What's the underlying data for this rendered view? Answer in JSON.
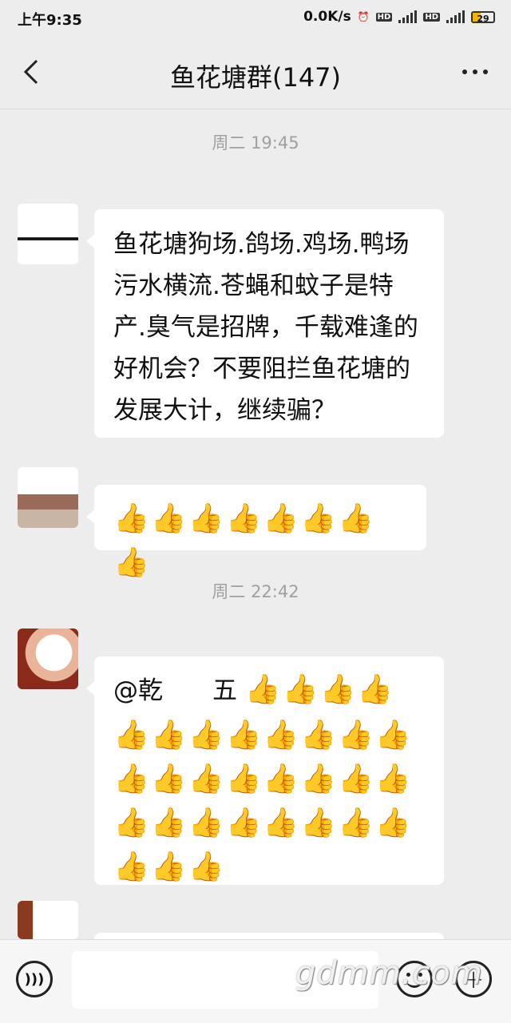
{
  "status_bar": {
    "time": "上午9:35",
    "speed": "0.0K/s",
    "alarm_icon": "alarm-icon",
    "hd1": "HD",
    "net1": "4G",
    "hd2": "HD",
    "net2": "4G",
    "battery": "29"
  },
  "header": {
    "title": "鱼花塘群(147)",
    "back_icon": "back-chevron-icon",
    "more_icon": "more-dots-icon"
  },
  "messages": [
    {
      "timestamp": "周二 19:45",
      "text": "鱼花塘狗场.鸽场.鸡场.鸭场污水横流.苍蝇和蚊子是特产.臭气是招牌，千载难逢的好机会？不要阻拦鱼花塘的发展大计，继续骗？"
    },
    {
      "text": "👍👍👍👍👍👍👍👍"
    },
    {
      "timestamp": "周二 22:42",
      "mention_prefix": "@乾",
      "mention_suffix": "五 ",
      "thumbs_line1": "👍👍👍👍",
      "thumbs_line2": "👍👍👍👍👍👍👍👍",
      "thumbs_line3": "👍👍👍👍👍👍👍👍",
      "thumbs_line4": "👍👍👍👍👍👍👍👍",
      "thumbs_line5": "👍👍👍"
    }
  ],
  "input_bar": {
    "placeholder": "",
    "voice_icon": "voice-icon",
    "emoji_icon": "emoji-icon",
    "plus_icon": "plus-icon"
  },
  "watermark": "gdmm.com"
}
